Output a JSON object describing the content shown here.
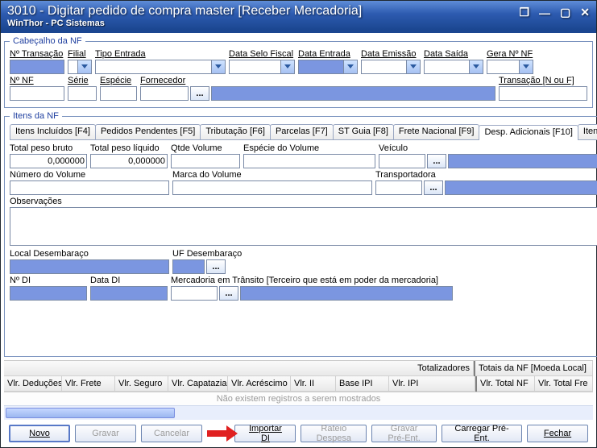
{
  "window": {
    "title": "3010 - Digitar pedido de compra master [Receber Mercadoria]",
    "subtitle": "WinThor - PC Sistemas"
  },
  "cabecalho": {
    "legend": "Cabeçalho da NF",
    "n_transacao": "Nº Transação",
    "filial": "Filial",
    "tipo_entrada": "Tipo Entrada",
    "data_selo_fiscal": "Data Selo Fiscal",
    "data_entrada": "Data Entrada",
    "data_emissao": "Data Emissão",
    "data_saida": "Data Saída",
    "gera_no_nf": "Gera Nº NF",
    "n_nf": "Nº NF",
    "serie": "Série",
    "especie": "Espécie",
    "fornecedor": "Fornecedor",
    "transacao_nouf": "Transação [N ou F]"
  },
  "itens": {
    "legend": "Itens da NF",
    "tabs": [
      "Itens Incluídos [F4]",
      "Pedidos Pendentes [F5]",
      "Tributação [F6]",
      "Parcelas [F7]",
      "ST Guia [F8]",
      "Frete Nacional [F9]",
      "Desp. Adicionais [F10]",
      "Itens"
    ],
    "total_peso_bruto": "Total peso bruto",
    "total_peso_bruto_val": "0,000000",
    "total_peso_liquido": "Total peso líquido",
    "total_peso_liquido_val": "0,000000",
    "qtde_volume": "Qtde Volume",
    "especie_volume": "Espécie do Volume",
    "veiculo": "Veículo",
    "numero_volume": "Número do Volume",
    "marca_volume": "Marca do Volume",
    "transportadora": "Transportadora",
    "observacoes": "Observações",
    "local_desembaraco": "Local Desembaraço",
    "uf_desembaraco": "UF Desembaraço",
    "n_di": "Nº DI",
    "data_di": "Data DI",
    "mercadoria_transito": "Mercadoria em Trânsito [Terceiro que está em poder da mercadoria]"
  },
  "grid": {
    "totalizadores": "Totalizadores",
    "totais_nf": "Totais da NF [Moeda Local]",
    "cols_left": [
      "Vlr. Deduções",
      "Vlr. Frete",
      "Vlr. Seguro",
      "Vlr. Capatazia",
      "Vlr. Acréscimo",
      "Vlr. II",
      "Base IPI",
      "Vlr. IPI"
    ],
    "cols_right": [
      "Vlr. Total NF",
      "Vlr. Total Fre"
    ],
    "no_records": "Não existem registros a serem mostrados"
  },
  "buttons": {
    "novo": "Novo",
    "gravar": "Gravar",
    "cancelar": "Cancelar",
    "importar_di": "Importar DI",
    "rateio_despesa": "Rateio Despesa",
    "gravar_pre_ent": "Gravar Pré-Ent.",
    "carregar_pre_ent": "Carregar Pré-Ent.",
    "fechar": "Fechar"
  }
}
